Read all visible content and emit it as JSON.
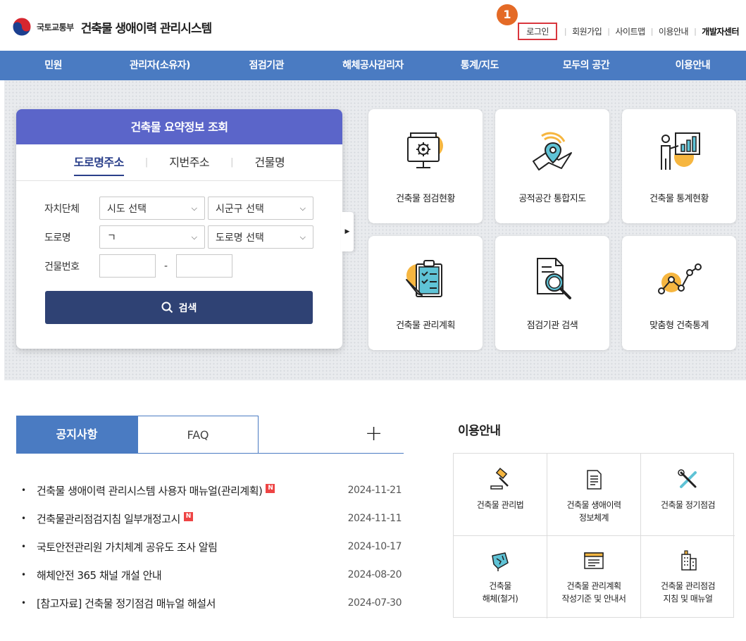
{
  "header": {
    "ministry": "국토교통부",
    "title": "건축물 생애이력 관리시스템",
    "util": {
      "login": "로그인",
      "signup": "회원가입",
      "sitemap": "사이트맵",
      "guide": "이용안내",
      "dev_center": "개발자센터"
    },
    "step_badge": "1"
  },
  "nav": [
    "민원",
    "관리자(소유자)",
    "점검기관",
    "해체공사감리자",
    "통계/지도",
    "모두의 공간",
    "이용안내"
  ],
  "search": {
    "title": "건축물 요약정보 조회",
    "tabs": [
      "도로명주소",
      "지번주소",
      "건물명"
    ],
    "fields": {
      "region_label": "자치단체",
      "sido": "시도 선택",
      "sigungu": "시군구 선택",
      "road_label": "도로명",
      "initial": "ㄱ",
      "road_select": "도로명 선택",
      "number_label": "건물번호",
      "dash": "-"
    },
    "button": "검색"
  },
  "tiles": [
    "건축물 점검현황",
    "공적공간 통합지도",
    "건축물 통계현황",
    "건축물 관리계획",
    "점검기관 검색",
    "맞춤형 건축통계"
  ],
  "notices": {
    "tab_notice": "공지사항",
    "tab_faq": "FAQ",
    "more": "+",
    "new_label": "N",
    "items": [
      {
        "title": "건축물 생애이력 관리시스템 사용자 매뉴얼(관리계획)",
        "date": "2024-11-21",
        "new": true
      },
      {
        "title": "건축물관리점검지침 일부개정고시",
        "date": "2024-11-11",
        "new": true
      },
      {
        "title": "국토안전관리원 가치체계 공유도 조사 알림",
        "date": "2024-10-17",
        "new": false
      },
      {
        "title": "해체안전 365 채널 개설 안내",
        "date": "2024-08-20",
        "new": false
      },
      {
        "title": "[참고자료] 건축물 정기점검 매뉴얼 해설서",
        "date": "2024-07-30",
        "new": false
      }
    ]
  },
  "guide": {
    "title": "이용안내",
    "items": [
      {
        "label": "건축물 관리법",
        "icon": "gavel-icon"
      },
      {
        "label": "건축물 생애이력\n정보체계",
        "icon": "document-icon"
      },
      {
        "label": "건축물 정기점검",
        "icon": "tools-icon"
      },
      {
        "label": "건축물\n해체(철거)",
        "icon": "demolition-icon"
      },
      {
        "label": "건축물 관리계획\n작성기준 및 안내서",
        "icon": "form-icon"
      },
      {
        "label": "건축물 관리점검\n지침 및 매뉴얼",
        "icon": "building-icon"
      }
    ]
  },
  "colors": {
    "nav": "#4a7bc2",
    "search_header": "#5b65c9",
    "search_button": "#2f4274",
    "accent_orange": "#f6b640",
    "badge": "#e46a26"
  }
}
